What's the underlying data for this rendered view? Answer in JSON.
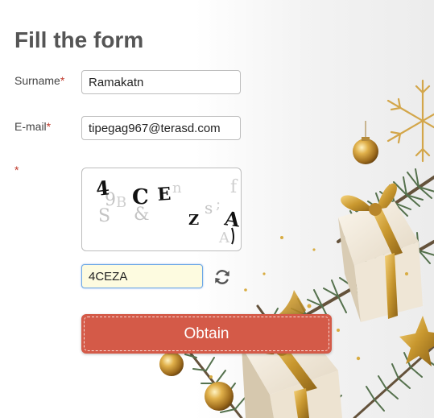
{
  "form": {
    "title": "Fill the form",
    "required_mark": "*",
    "surname": {
      "label": "Surname",
      "value": "Ramakatn"
    },
    "email": {
      "label": "E-mail",
      "value": "tipegag967@terasd.com"
    },
    "captcha": {
      "image_glyphs": {
        "main": [
          "4",
          "C",
          "E",
          "Z",
          "A"
        ],
        "noise": [
          "9",
          "B",
          "n",
          "S",
          "&",
          "s",
          ";",
          "f",
          "A"
        ]
      },
      "input_value": "4CEZA",
      "refresh_icon": "refresh-icon"
    },
    "submit_label": "Obtain"
  },
  "colors": {
    "title": "#555555",
    "required": "#c0392b",
    "button": "#d45a48",
    "captcha_input_bg": "#fdfbe0",
    "captcha_input_border": "#6ea8e6"
  }
}
